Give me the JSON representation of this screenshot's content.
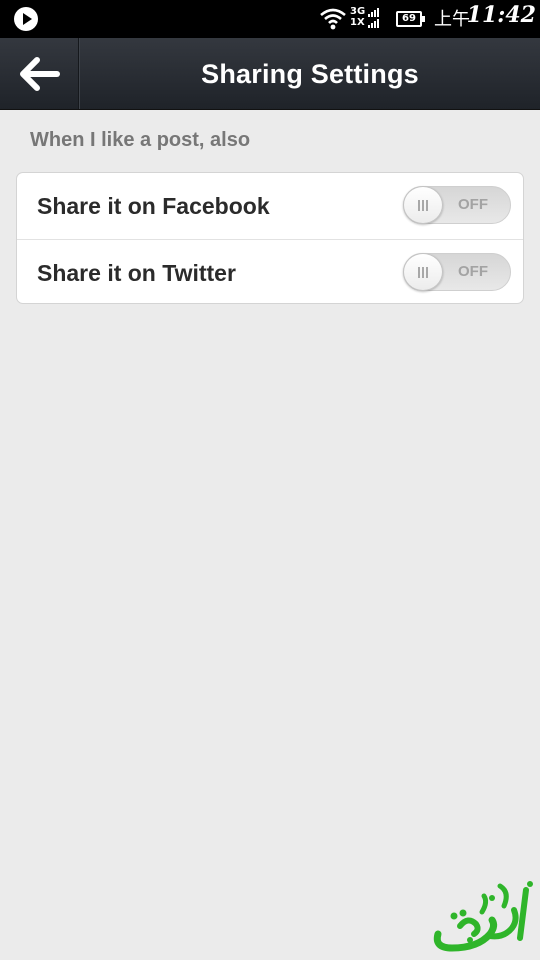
{
  "status_bar": {
    "network_top": "3G",
    "network_bottom": "1X",
    "battery": "69",
    "ampm": "上午",
    "time": "11:42",
    "icons": [
      "media-play-icon",
      "wifi-icon",
      "signal-icon",
      "battery-icon"
    ]
  },
  "action_bar": {
    "title": "Sharing Settings",
    "back_icon": "arrow-left-icon",
    "background_color": "#2a2e34"
  },
  "section": {
    "header": "When I like a post, also",
    "items": [
      {
        "label": "Share it on Facebook",
        "toggle_text": "OFF",
        "on": false
      },
      {
        "label": "Share it on Twitter",
        "toggle_text": "OFF",
        "on": false
      }
    ]
  },
  "watermark": {
    "text": "ئالتۇن",
    "color": "#2fb52a"
  }
}
